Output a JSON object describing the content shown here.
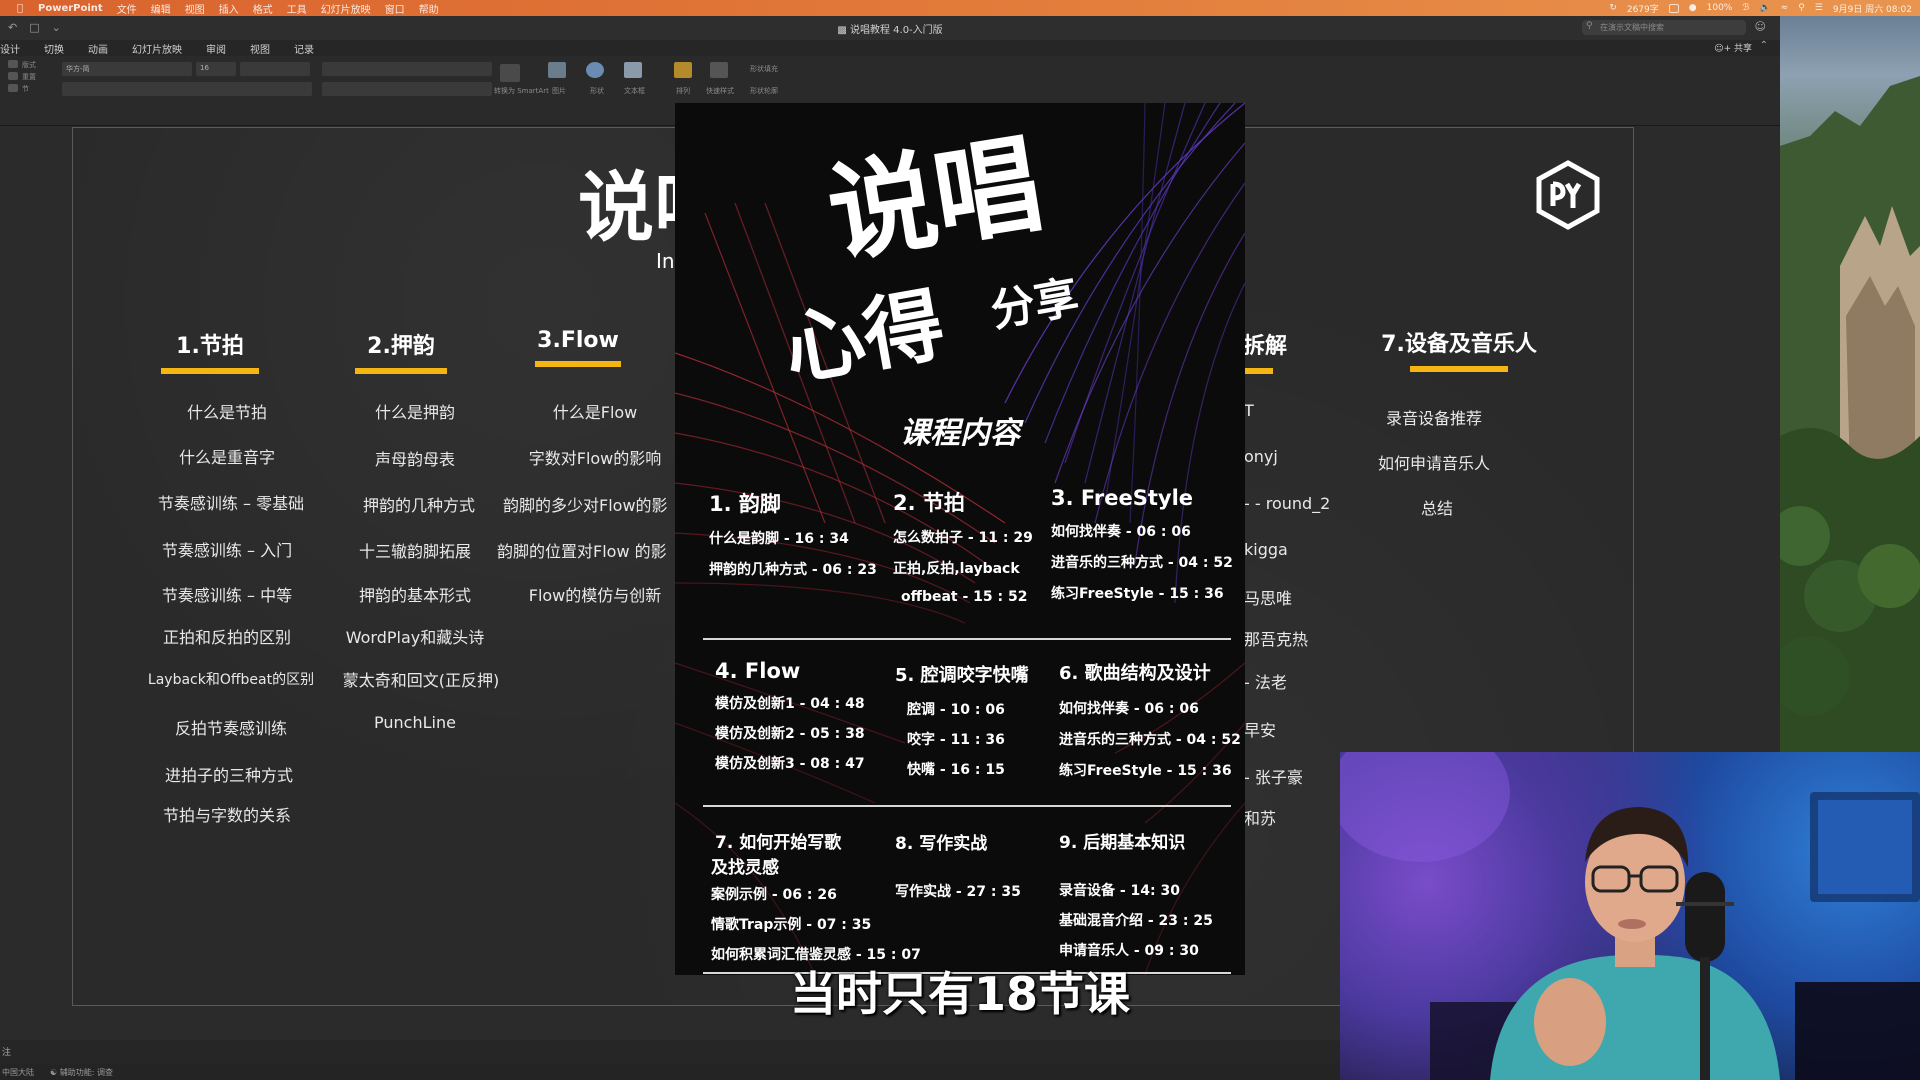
{
  "menubar": {
    "app": "PowerPoint",
    "items": [
      "文件",
      "编辑",
      "视图",
      "插入",
      "格式",
      "工具",
      "幻灯片放映",
      "窗口",
      "帮助"
    ],
    "status": {
      "count": "2679字",
      "battery": "100%",
      "datetime": "9月9日 周六 08:02"
    }
  },
  "window": {
    "title": "说唱教程 4.0-入门版",
    "search_placeholder": "在演示文稿中搜索",
    "tabs": [
      "设计",
      "切换",
      "动画",
      "幻灯片放映",
      "审阅",
      "视图",
      "记录"
    ],
    "share": "共享"
  },
  "ribbon": {
    "layout": "版式",
    "reset": "重置",
    "section": "节",
    "font": "华方-简",
    "font_size": "16",
    "convert": "转换为 SmartArt",
    "picture": "图片",
    "shape": "形状",
    "textbox": "文本框",
    "arrange": "排列",
    "quick_styles": "快速样式",
    "shape_fill": "形状填充",
    "shape_outline": "形状轮廓"
  },
  "status": {
    "notes": "注",
    "language": "中国大陆",
    "accessibility": "辅助功能: 调查"
  },
  "slide": {
    "title": "说唱",
    "subtitle": "In",
    "columns": [
      {
        "header": "1.节拍",
        "items": [
          "什么是节拍",
          "什么是重音字",
          "节奏感训练 – 零基础",
          "节奏感训练 – 入门",
          "节奏感训练 – 中等",
          "正拍和反拍的区别",
          "Layback和Offbeat的区别",
          "反拍节奏感训练",
          "进拍子的三种方式",
          "节拍与字数的关系"
        ]
      },
      {
        "header": "2.押韵",
        "items": [
          "什么是押韵",
          "声母韵母表",
          "押韵的几种方式",
          "十三辙韵脚拓展",
          "押韵的基本形式",
          "WordPlay和藏头诗",
          "蒙太奇和回文(正反押)",
          "PunchLine"
        ]
      },
      {
        "header": "3.Flow",
        "items": [
          "什么是Flow",
          "字数对Flow的影响",
          "韵脚的多少对Flow的影",
          "韵脚的位置对Flow 的影",
          "Flow的模仿与创新"
        ]
      },
      {
        "header": "拆解",
        "items": [
          "T",
          "onyj",
          "- - round_2",
          "kigga",
          "马思唯",
          "那吾克热",
          "- 法老",
          "早安",
          "- 张子豪",
          "和苏"
        ]
      },
      {
        "header": "7.设备及音乐人",
        "items": [
          "录音设备推荐",
          "如何申请音乐人",
          "总结"
        ]
      }
    ]
  },
  "poster": {
    "h1": "说唱",
    "h2": "心得",
    "h3": "分享",
    "subtitle": "课程内容",
    "sections": [
      {
        "title": "1. 韵脚",
        "items": [
          "什么是韵脚 - 16 : 34",
          "押韵的几种方式 - 06 : 23"
        ]
      },
      {
        "title": "2. 节拍",
        "items": [
          "怎么数拍子 - 11 : 29",
          "正拍,反拍,layback",
          "offbeat - 15 : 52"
        ]
      },
      {
        "title": "3. FreeStyle",
        "items": [
          "如何找伴奏 - 06 : 06",
          "进音乐的三种方式 - 04 : 52",
          "练习FreeStyle - 15 : 36"
        ]
      },
      {
        "title": "4. Flow",
        "items": [
          "模仿及创新1 - 04 : 48",
          "模仿及创新2 - 05 : 38",
          "模仿及创新3 - 08 : 47"
        ]
      },
      {
        "title": "5. 腔调咬字快嘴",
        "items": [
          "腔调 - 10 : 06",
          "咬字 - 11 : 36",
          "快嘴 - 16 : 15"
        ]
      },
      {
        "title": "6. 歌曲结构及设计",
        "items": [
          "如何找伴奏 - 06 : 06",
          "进音乐的三种方式 - 04 : 52",
          "练习FreeStyle - 15 : 36"
        ]
      },
      {
        "title": "7. 如何开始写歌",
        "title2": "及找灵感",
        "items": [
          "案例示例 - 06 : 26",
          "情歌Trap示例 - 07 : 35",
          "如何积累词汇借鉴灵感 - 15 : 07"
        ]
      },
      {
        "title": "8. 写作实战",
        "items": [
          "写作实战 - 27 : 35"
        ]
      },
      {
        "title": "9. 后期基本知识",
        "items": [
          "录音设备 - 14: 30",
          "基础混音介绍 - 23 : 25",
          "申请音乐人 - 09 : 30"
        ]
      }
    ]
  },
  "caption": "当时只有18节课"
}
